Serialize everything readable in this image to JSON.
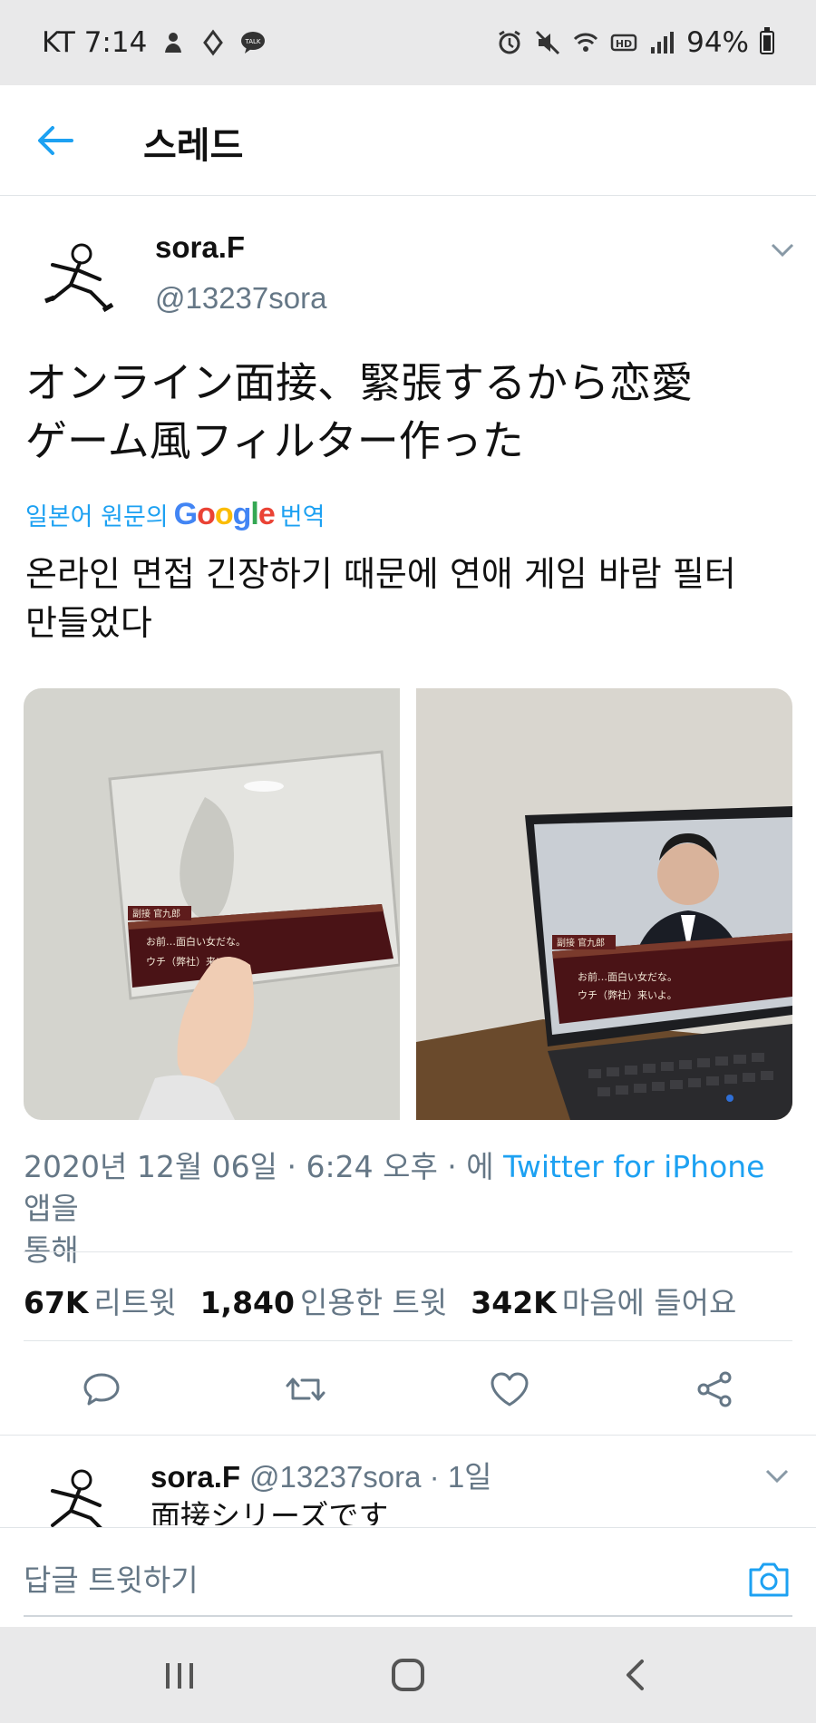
{
  "status_bar": {
    "carrier_time": "KT 7:14",
    "battery": "94%"
  },
  "header": {
    "title": "스레드"
  },
  "tweet": {
    "author_name": "sora.F",
    "author_handle": "@13237sora",
    "text_line1": "オンライン面接、緊張するから恋愛",
    "text_line2": "ゲーム風フィルター作った",
    "translate_prefix": "일본어 원문의",
    "translate_google": "Google",
    "translate_suffix": "번역",
    "translated_line1": "온라인 면접 긴장하기 때문에 연애 게임 바람 필터",
    "translated_line2": "만들었다",
    "media": [
      {
        "caption_name": "副接 官九郎",
        "caption_line1": "お前…面白い女だな。",
        "caption_line2": "ウチ（弊社）来いよ。"
      },
      {
        "caption_name": "副接 官九郎",
        "caption_line1": "お前…面白い女だな。",
        "caption_line2": "ウチ（弊社）来いよ。"
      }
    ],
    "meta_date": "2020년 12월 06일 · 6:24 오후 · 에 ",
    "meta_source": "Twitter for iPhone",
    "meta_suffix": " 앱을",
    "meta_line2": "통해",
    "stats": {
      "retweets_count": "67K",
      "retweets_label": "리트윗",
      "quotes_count": "1,840",
      "quotes_label": "인용한 트윗",
      "likes_count": "342K",
      "likes_label": "마음에 들어요"
    }
  },
  "reply": {
    "author_name": "sora.F",
    "handle_time": "@13237sora · 1일",
    "text": "面接シリーズです"
  },
  "compose": {
    "placeholder": "답글 트윗하기"
  },
  "colors": {
    "accent": "#1da1f2",
    "muted": "#657786",
    "text": "#111111",
    "bar": "#e9e9ea"
  }
}
